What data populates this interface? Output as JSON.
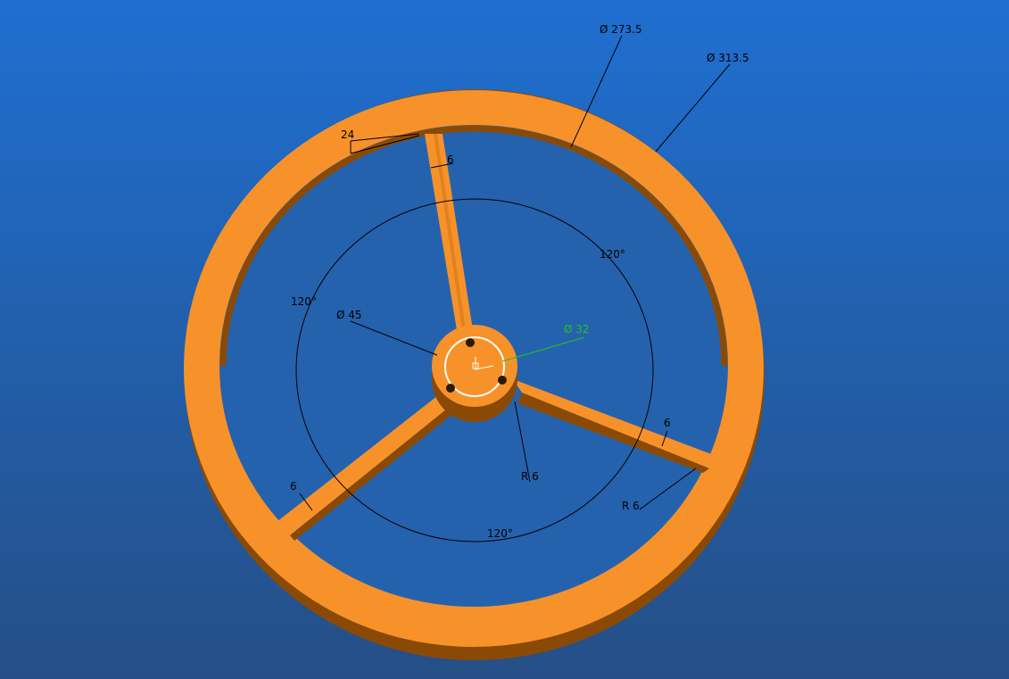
{
  "viewport": {
    "background_top": "#1f6fd1",
    "background_bottom": "#254f86",
    "part_color": "#f7922a",
    "part_shadow": "#8a4a06",
    "highlight_color": "#ffffff",
    "selected_dim_color": "#22c222"
  },
  "dimensions": {
    "outer_diameter": "Ø 313.5",
    "inner_diameter": "Ø 273.5",
    "chamfer": "24",
    "spoke_width_top": "6",
    "spoke_width_right": "6",
    "spoke_width_left": "6",
    "angle_top_right": "120°",
    "angle_left": "120°",
    "angle_bottom": "120°",
    "hub_circle_diameter": "Ø 45",
    "hub_bore_diameter": "Ø 32",
    "fillet_hub": "R 6",
    "fillet_rim": "R 6"
  }
}
